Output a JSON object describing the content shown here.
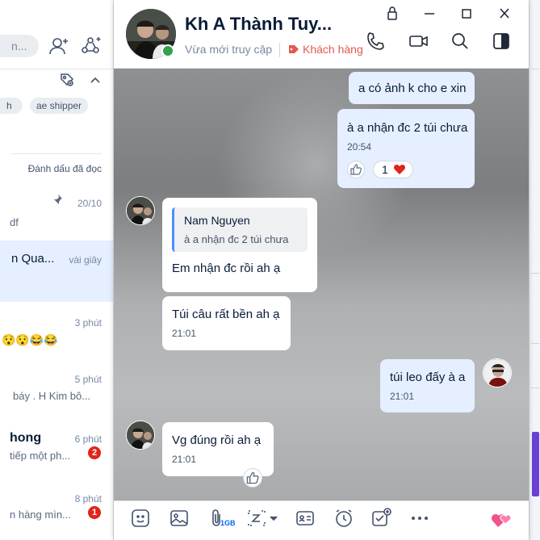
{
  "colors": {
    "accent": "#0068ff",
    "online": "#30a24a",
    "badge": "#e0251b",
    "tag": "#e2594f",
    "my_bubble": "#e5efff"
  },
  "sidebar": {
    "search_snippet": "n...",
    "chips": [
      "h",
      "ae shipper"
    ],
    "mark_read_label": "Đánh dấu đã đọc",
    "conversations": [
      {
        "name": "",
        "snippet": "df",
        "time": "20/10",
        "pinned": true
      },
      {
        "name": "n Qua...",
        "snippet": "",
        "time": "vài giây",
        "active": true
      },
      {
        "name": "",
        "snippet": "😯😯😂😂",
        "time": "3 phút"
      },
      {
        "name": "",
        "snippet": "báy . H Kim bô...",
        "time": "5 phút"
      },
      {
        "name": "hong",
        "snippet": "tiếp một ph...",
        "time": "6 phút",
        "badge": "2"
      },
      {
        "name": "",
        "snippet": "n hàng mìn...",
        "time": "8 phút",
        "badge": "1"
      }
    ]
  },
  "chat": {
    "title": "Kh A Thành Tuy...",
    "status": "Vừa mới truy cập",
    "tag": "Khách hàng",
    "messages": [
      {
        "from": "me",
        "text": "a có ảnh k cho e xin"
      },
      {
        "from": "me",
        "text": "à a nhận đc 2 túi chưa",
        "time": "20:54",
        "reaction_count": "1"
      },
      {
        "from": "them",
        "quote_name": "Nam Nguyen",
        "quote_text": "à a nhận đc 2 túi chưa",
        "text": "Em nhận đc rồi ah ạ"
      },
      {
        "from": "them",
        "text": "Túi câu rất bền ah ạ",
        "time": "21:01"
      },
      {
        "from": "me",
        "text": "túi leo đấy à a",
        "time": "21:01"
      },
      {
        "from": "them",
        "text": "Vg đúng rồi ah ạ",
        "time": "21:01"
      }
    ]
  },
  "toolbar": {
    "items": [
      "sticker-icon",
      "image-icon",
      "attachment-icon",
      "screenshot-icon",
      "contact-card-icon",
      "reminder-icon",
      "task-icon",
      "more-icon",
      "heart-sticker-icon"
    ],
    "attachment_limit": "1GB"
  }
}
